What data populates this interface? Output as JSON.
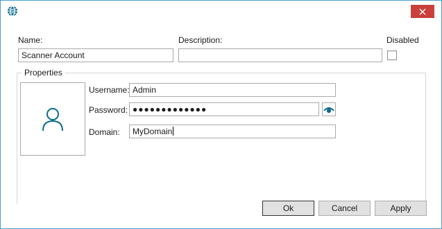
{
  "window": {
    "accent_color": "#0b6a8c",
    "close_color": "#c9413a",
    "icons": {
      "app": "globe-icon",
      "close": "close-icon"
    }
  },
  "form": {
    "name_label": "Name:",
    "name_value": "Scanner Account",
    "description_label": "Description:",
    "description_value": "",
    "disabled_label": "Disabled",
    "disabled_checked": false
  },
  "properties": {
    "title": "Properties",
    "avatar_icon": "user-icon",
    "username_label": "Username:",
    "username_value": "Admin",
    "password_label": "Password:",
    "password_value": "●●●●●●●●●●●●●",
    "reveal_icon": "eye-icon",
    "domain_label": "Domain:",
    "domain_value": "MyDomain"
  },
  "buttons": {
    "ok": "Ok",
    "cancel": "Cancel",
    "apply": "Apply"
  }
}
